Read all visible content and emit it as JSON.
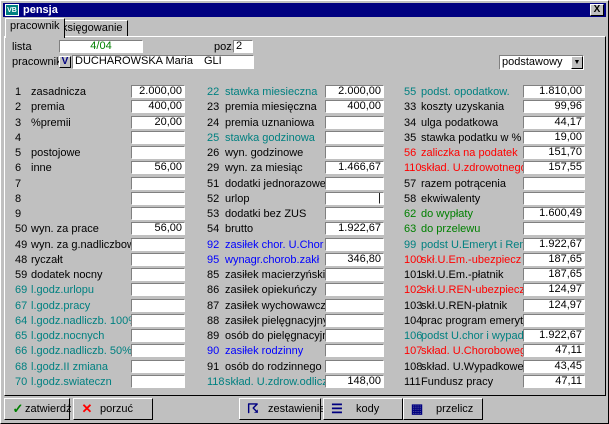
{
  "window": {
    "title": "pensja",
    "app_icon": "VB",
    "close": "X"
  },
  "tabs": [
    {
      "label": "pracownik"
    },
    {
      "label": "księgowanie"
    }
  ],
  "header": {
    "lista_label": "lista",
    "lista_value": "4/04",
    "poz_label": "poz.",
    "poz_value": "2",
    "pracownik_label": "pracownik",
    "pracownik_name": "DUCHAROWSKA Maria",
    "pracownik_code": "GLI",
    "v_button": "V",
    "mode_select": "podstawowy"
  },
  "colors": {
    "teal": "#008080",
    "blue": "#0000ff",
    "red": "#ff0000",
    "green": "#008000"
  },
  "col1": [
    {
      "no": "1",
      "label": "zasadnicza",
      "value": "2.000,00",
      "color": "black"
    },
    {
      "no": "2",
      "label": "premia",
      "value": "400,00",
      "color": "black"
    },
    {
      "no": "3",
      "label": "%premii",
      "value": "20,00",
      "color": "black"
    },
    {
      "no": "4",
      "label": "",
      "value": "",
      "color": "black"
    },
    {
      "no": "5",
      "label": "postojowe",
      "value": "",
      "color": "black"
    },
    {
      "no": "6",
      "label": "inne",
      "value": "56,00",
      "color": "black"
    },
    {
      "no": "7",
      "label": "",
      "value": "",
      "color": "black"
    },
    {
      "no": "8",
      "label": "",
      "value": "",
      "color": "black"
    },
    {
      "no": "9",
      "label": "",
      "value": "",
      "color": "black"
    },
    {
      "no": "50",
      "label": "wyn. za prace",
      "value": "56,00",
      "color": "black"
    },
    {
      "no": "49",
      "label": "wyn. za g.nadliczbowe",
      "value": "",
      "color": "black"
    },
    {
      "no": "48",
      "label": "ryczałt",
      "value": "",
      "color": "black"
    },
    {
      "no": "59",
      "label": "dodatek nocny",
      "value": "",
      "color": "black"
    },
    {
      "no": "69",
      "label": "l.godz.urlopu",
      "value": "",
      "color": "teal"
    },
    {
      "no": "67",
      "label": "l.godz.pracy",
      "value": "",
      "color": "teal"
    },
    {
      "no": "64",
      "label": "l.godz.nadliczb. 100%",
      "value": "",
      "color": "teal"
    },
    {
      "no": "65",
      "label": "l.godz.nocnych",
      "value": "",
      "color": "teal"
    },
    {
      "no": "66",
      "label": "l.godz.nadliczb. 50%",
      "value": "",
      "color": "teal"
    },
    {
      "no": "68",
      "label": "l.godz.II zmiana",
      "value": "",
      "color": "teal"
    },
    {
      "no": "70",
      "label": "l.godz.swiateczn",
      "value": "",
      "color": "teal"
    }
  ],
  "col2": [
    {
      "no": "22",
      "label": "stawka miesieczna",
      "value": "2.000,00",
      "color": "teal"
    },
    {
      "no": "23",
      "label": "premia miesięczna",
      "value": "400,00",
      "color": "black"
    },
    {
      "no": "24",
      "label": "premia uznaniowa",
      "value": "",
      "color": "black"
    },
    {
      "no": "25",
      "label": "stawka godzinowa",
      "value": "",
      "color": "teal"
    },
    {
      "no": "26",
      "label": "wyn. godzinowe",
      "value": "",
      "color": "black"
    },
    {
      "no": "29",
      "label": "wyn. za miesiąc",
      "value": "1.466,67",
      "color": "black"
    },
    {
      "no": "51",
      "label": "dodatki jednorazowe",
      "value": "",
      "color": "black"
    },
    {
      "no": "52",
      "label": "urlop",
      "value": "|",
      "color": "black"
    },
    {
      "no": "53",
      "label": "dodatki bez ZUS",
      "value": "",
      "color": "black"
    },
    {
      "no": "54",
      "label": "brutto",
      "value": "1.922,67",
      "color": "black"
    },
    {
      "no": "92",
      "label": "zasiłek chor. U.Chor",
      "value": "",
      "color": "blue"
    },
    {
      "no": "95",
      "label": "wynagr.chorob.zakł",
      "value": "346,80",
      "color": "blue"
    },
    {
      "no": "85",
      "label": "zasiłek macierzyński",
      "value": "",
      "color": "black"
    },
    {
      "no": "86",
      "label": "zasiłek opiekuńczy",
      "value": "",
      "color": "black"
    },
    {
      "no": "87",
      "label": "zasiłek wychowawczy",
      "value": "",
      "color": "black"
    },
    {
      "no": "88",
      "label": "zasiłek pielęgnacyjny",
      "value": "",
      "color": "black"
    },
    {
      "no": "89",
      "label": "osób do pielęgnacyjnego",
      "value": "",
      "color": "black"
    },
    {
      "no": "90",
      "label": "zasiłek rodzinny",
      "value": "",
      "color": "blue"
    },
    {
      "no": "91",
      "label": "osób do rodzinnego",
      "value": "",
      "color": "black"
    },
    {
      "no": "118",
      "label": "skład. U.zdrow.odlicz",
      "value": "148,00",
      "color": "teal"
    }
  ],
  "col3": [
    {
      "no": "55",
      "label": "podst. opodatkow.",
      "value": "1.810,00",
      "color": "teal"
    },
    {
      "no": "33",
      "label": "koszty uzyskania",
      "value": "99,96",
      "color": "black"
    },
    {
      "no": "34",
      "label": "ulga podatkowa",
      "value": "44,17",
      "color": "black"
    },
    {
      "no": "35",
      "label": "stawka podatku w %",
      "value": "19,00",
      "color": "black"
    },
    {
      "no": "56",
      "label": "zaliczka na podatek",
      "value": "151,70",
      "color": "red"
    },
    {
      "no": "110",
      "label": "skład. U.zdrowotnego",
      "value": "157,55",
      "color": "red"
    },
    {
      "no": "57",
      "label": "razem potrącenia",
      "value": "",
      "color": "black"
    },
    {
      "no": "58",
      "label": "ekwiwalenty",
      "value": "",
      "color": "black"
    },
    {
      "no": "62",
      "label": "do wypłaty",
      "value": "1.600,49",
      "color": "green"
    },
    {
      "no": "63",
      "label": "do przelewu",
      "value": "",
      "color": "green"
    },
    {
      "no": "99",
      "label": "podst U.Emeryt i Ren",
      "value": "1.922,67",
      "color": "teal"
    },
    {
      "no": "100",
      "label": "skł.U.Em.-ubezpiecz",
      "value": "187,65",
      "color": "red"
    },
    {
      "no": "101",
      "label": "skł.U.Em.-płatnik",
      "value": "187,65",
      "color": "black"
    },
    {
      "no": "102",
      "label": "skł.U.REN-ubezpiecz",
      "value": "124,97",
      "color": "red"
    },
    {
      "no": "103",
      "label": "skł.U.REN-płatnik",
      "value": "124,97",
      "color": "black"
    },
    {
      "no": "104",
      "label": "prac program emerytalny",
      "value": "",
      "color": "black"
    },
    {
      "no": "106",
      "label": "podst U.chor i wypadk",
      "value": "1.922,67",
      "color": "teal"
    },
    {
      "no": "107",
      "label": "skład. U.Chorobowego",
      "value": "47,11",
      "color": "red"
    },
    {
      "no": "108",
      "label": "skład. U.Wypadkowego",
      "value": "43,45",
      "color": "black"
    },
    {
      "no": "111",
      "label": "Fundusz pracy",
      "value": "47,11",
      "color": "black"
    }
  ],
  "buttons": {
    "approve": "zatwierdź",
    "discard": "porzuć",
    "statement": "zestawienie",
    "codes": "kody",
    "recalc": "przelicz"
  }
}
